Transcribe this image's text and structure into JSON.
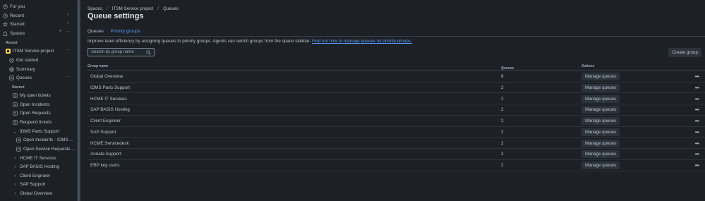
{
  "sidebar": {
    "top_items": [
      {
        "label": "For you",
        "icon": "user-circle-icon"
      },
      {
        "label": "Recent",
        "icon": "clock-icon"
      },
      {
        "label": "Starred",
        "icon": "star-icon"
      },
      {
        "label": "Spaces",
        "icon": "spaces-icon"
      }
    ],
    "recent_heading": "Recent",
    "project": {
      "label": "ITSM Service project",
      "icon": "project-icon"
    },
    "project_items": [
      {
        "label": "Get started",
        "icon": "rocket-icon"
      },
      {
        "label": "Summary",
        "icon": "globe-icon"
      },
      {
        "label": "Queues",
        "icon": "queues-icon"
      }
    ],
    "starred_heading": "Starred",
    "queue_items": [
      {
        "label": "My open tickets"
      },
      {
        "label": "Open Incidents"
      },
      {
        "label": "Open Requests"
      },
      {
        "label": "Reopend tickets"
      }
    ],
    "group_expanded": "IDMS Parts Support",
    "group_children": [
      {
        "label": "Open Incidents - IDMS ..."
      },
      {
        "label": "Open Service Requests ..."
      }
    ],
    "groups_collapsed": [
      {
        "label": "HCME IT Services"
      },
      {
        "label": "SAP BASIS Hosting"
      },
      {
        "label": "Client Engineer"
      },
      {
        "label": "SAP Support"
      },
      {
        "label": "Global Overview"
      }
    ]
  },
  "breadcrumb": [
    "Spaces",
    "ITSM Service project",
    "Queues"
  ],
  "page_title": "Queue settings",
  "tabs": [
    {
      "label": "Queues",
      "active": false
    },
    {
      "label": "Priority groups",
      "active": true
    }
  ],
  "description": "Improve team efficiency by assigning queues to priority groups. Agents can switch groups from the space sidebar.",
  "description_link": "Find out how to manage queues by priority groups.",
  "search": {
    "placeholder": "Search by group name"
  },
  "create_button": "Create group",
  "table": {
    "headers": {
      "name": "Group name",
      "queues": "Queues",
      "actions": "Actions"
    },
    "action_label": "Manage queues",
    "rows": [
      {
        "name": "Global Overview",
        "queues": "6"
      },
      {
        "name": "IDMS Parts Support",
        "queues": "2"
      },
      {
        "name": "HCME IT Services",
        "queues": "2"
      },
      {
        "name": "SAP BASIS Hosting",
        "queues": "2"
      },
      {
        "name": "Client Engineer",
        "queues": "2"
      },
      {
        "name": "SAP Support",
        "queues": "2"
      },
      {
        "name": "HCME Servicedesk",
        "queues": "2"
      },
      {
        "name": "Annata Support",
        "queues": "2"
      },
      {
        "name": "ERP key users",
        "queues": "2"
      }
    ]
  },
  "colors": {
    "background": "#1d2125",
    "accent": "#579dff",
    "text": "#b6c2cf"
  }
}
